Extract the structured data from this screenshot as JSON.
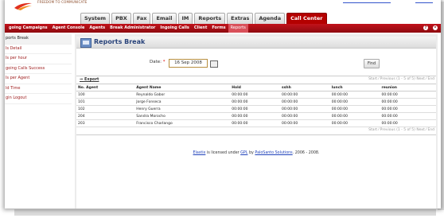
{
  "header": {
    "brand_text": "FREEDOM TO COMMUNICATE",
    "main_tabs": [
      "System",
      "PBX",
      "Fax",
      "Email",
      "IM",
      "Reports",
      "Extras",
      "Agenda",
      "Call Center"
    ],
    "active_tab_index": 8
  },
  "submenu": {
    "items": [
      "going Campaigns",
      "Agent Console",
      "Agents",
      "Break Administrator",
      "Ingoing Calls",
      "Client",
      "Forms",
      "Reports"
    ],
    "active_index": 7,
    "icons": [
      "help-icon",
      "settings-icon"
    ]
  },
  "sidebar": {
    "items": [
      "ports Break",
      "ls Detail",
      "ls per hour",
      "going Calls Success",
      "ls per Agent",
      "ld Time",
      "gin Logout"
    ],
    "active_index": 0
  },
  "page": {
    "title": "Reports Break",
    "date_label": "Date:",
    "required_mark": "*",
    "date_value": "16 Sep 2008",
    "find_label": "Find"
  },
  "table": {
    "export_label": "Export",
    "pager_text": "Start ⁄ Previous (1 - 5 of 5) Next ⁄ End",
    "columns": [
      "No. Agent",
      "Agent Name",
      "Hold",
      "sshh",
      "lunch",
      "reunion"
    ],
    "rows": [
      [
        "100",
        "Reynaldo Gabor",
        "00:00:00",
        "00:00:00",
        "00:00:00",
        "00:00:00"
      ],
      [
        "101",
        "Jorge Fonseca",
        "00:00:00",
        "00:00:00",
        "00:00:00",
        "00:00:00"
      ],
      [
        "102",
        "Henry Guerra",
        "00:00:00",
        "00:00:00",
        "00:00:00",
        "00:00:00"
      ],
      [
        "204",
        "Sandra Morocho",
        "00:00:00",
        "00:00:00",
        "00:00:00",
        "00:00:00"
      ],
      [
        "203",
        "Francisco Charlango",
        "00:00:00",
        "00:00:00",
        "00:00:00",
        "00:00:00"
      ]
    ]
  },
  "footer": {
    "product_link": "Elastix",
    "text_1": " is licensed under ",
    "license_link": "GPL",
    "text_2": " by ",
    "company_link": "PaloSanto Solutions",
    "text_3": ". 2006 - 2008."
  }
}
